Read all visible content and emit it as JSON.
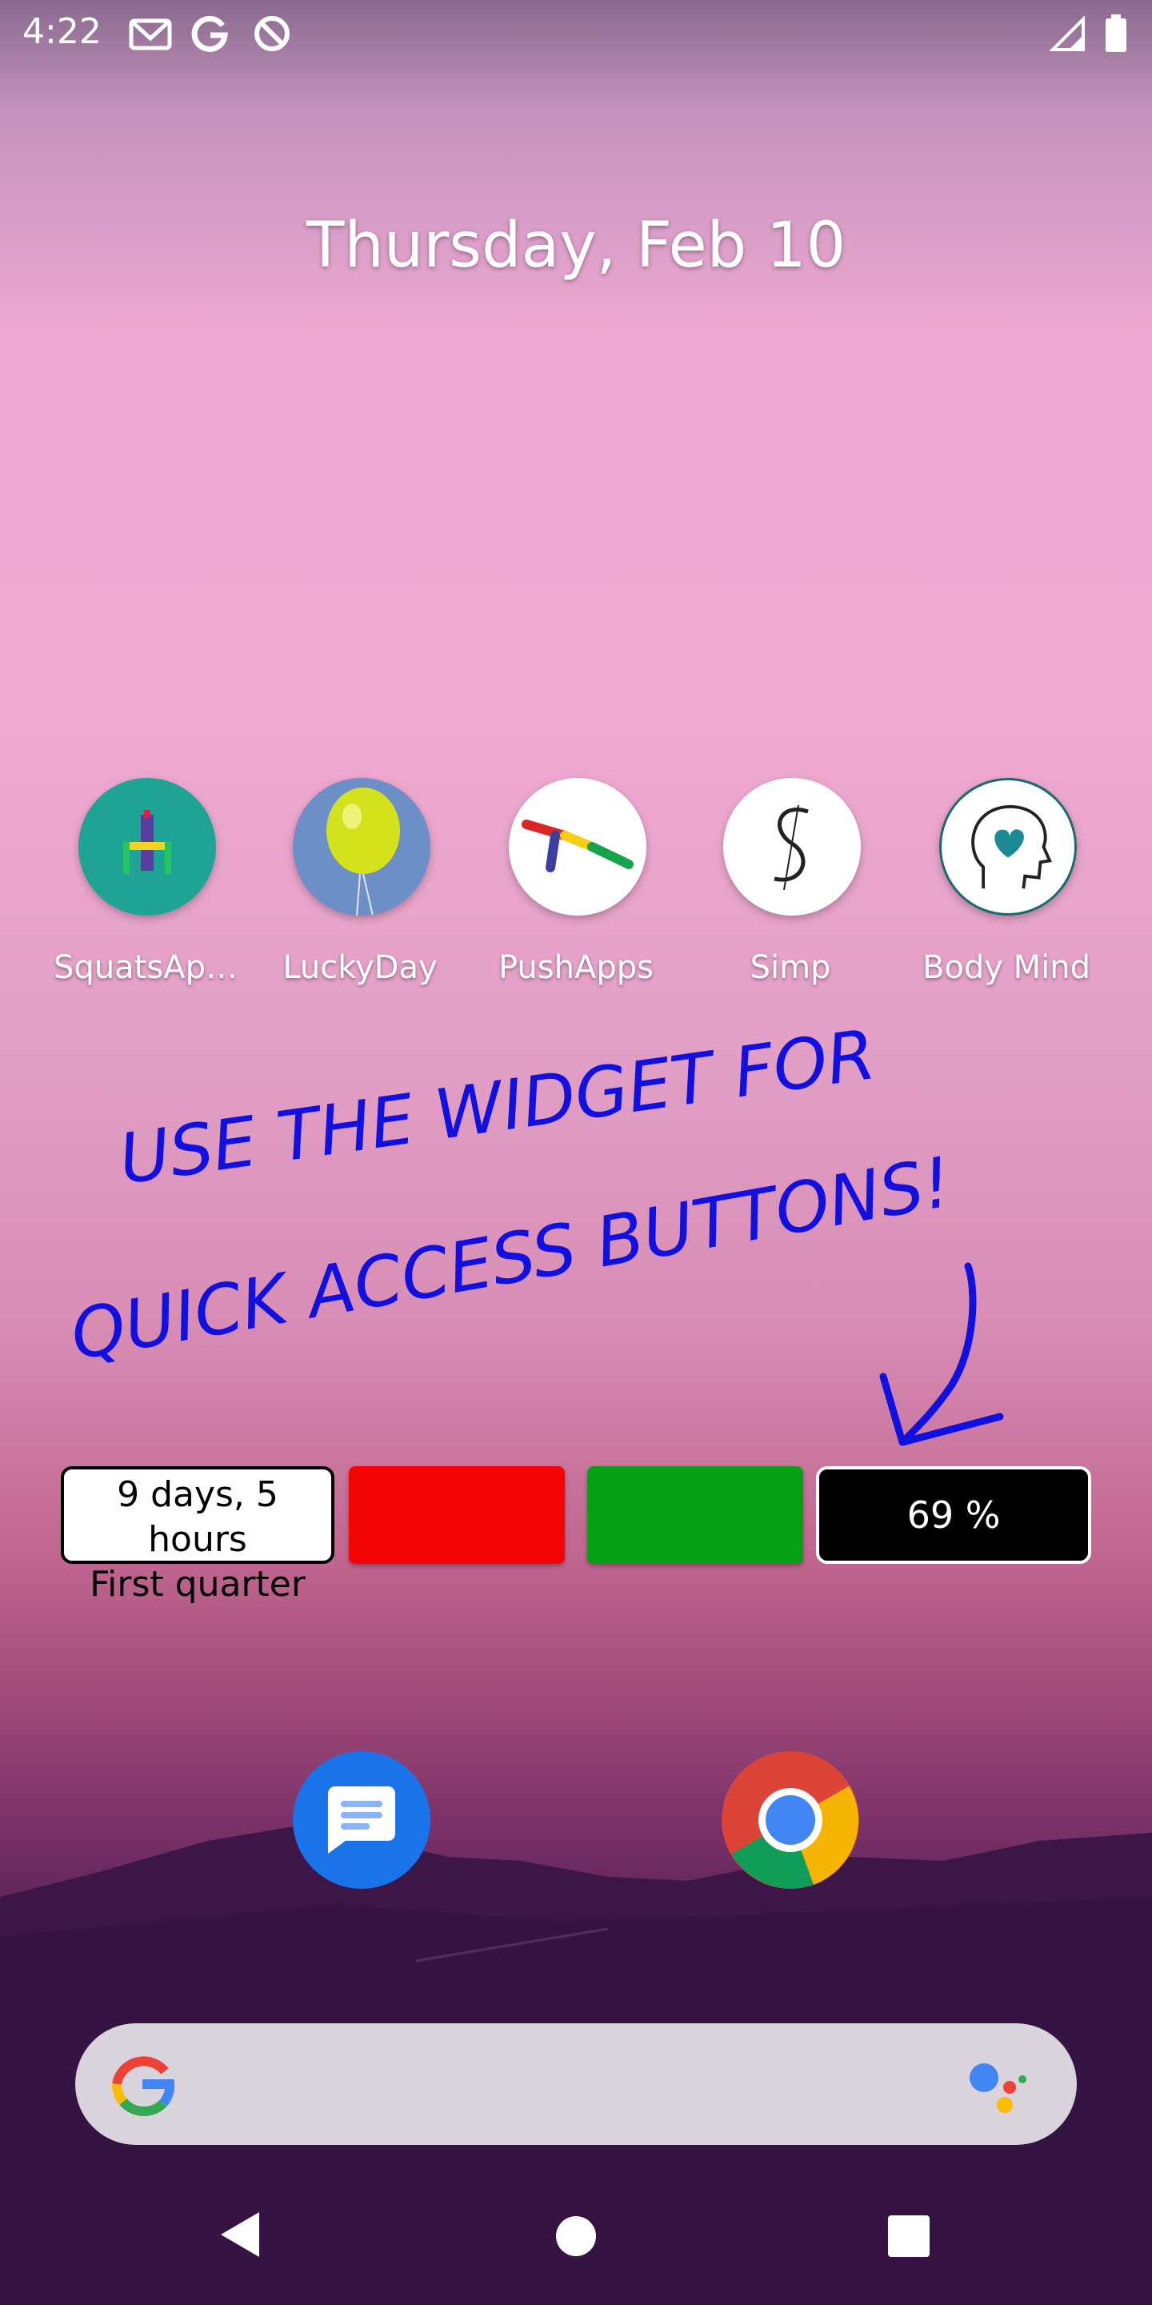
{
  "status_bar": {
    "time": "4:22",
    "left_icons": [
      "gmail-icon",
      "google-icon",
      "no-disturb-icon"
    ],
    "right_icons": [
      "signal-icon",
      "battery-icon"
    ]
  },
  "date_widget": {
    "text": "Thursday, Feb 10"
  },
  "apps": [
    {
      "label": "SquatsAp…",
      "icon": "squats-app-icon"
    },
    {
      "label": "LuckyDay",
      "icon": "balloon-icon"
    },
    {
      "label": "PushApps",
      "icon": "pushapps-icon"
    },
    {
      "label": "Simp",
      "icon": "simp-s-icon"
    },
    {
      "label": "Body Mind",
      "icon": "head-heart-icon"
    }
  ],
  "annotation": {
    "line1": "USE THE WIDGET FOR",
    "line2": "QUICK ACCESS BUTTONS!",
    "color": "#1010e0"
  },
  "widgets": {
    "moon": {
      "line1": "9 days, 5 hours",
      "line2": "First quarter"
    },
    "red_button": {
      "color": "#f40404"
    },
    "green_button": {
      "color": "#06a014"
    },
    "battery": {
      "text": "69 %"
    }
  },
  "dock": [
    {
      "icon": "messages-icon"
    },
    {
      "icon": "chrome-icon"
    }
  ],
  "search": {
    "icons": [
      "google-g-icon",
      "assistant-icon"
    ]
  },
  "nav_bar": {
    "icons": [
      "back-icon",
      "home-icon",
      "recents-icon"
    ]
  }
}
